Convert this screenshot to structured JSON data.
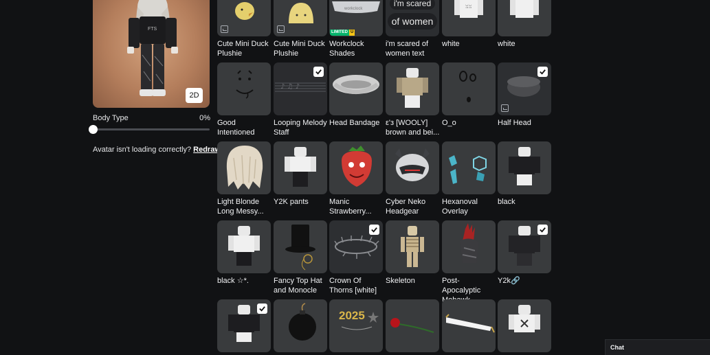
{
  "avatar": {
    "view_toggle": "2D",
    "body_type_label": "Body Type",
    "body_type_value": "0%",
    "body_type_progress": 0,
    "loading_msg": "Avatar isn't loading correctly?",
    "redraw_label": "Redraw"
  },
  "items": [
    {
      "name": "Cute Mini Duck Plushie",
      "equipped": false,
      "badge": "dynamic"
    },
    {
      "name": "Cute Mini Duck Plushie",
      "equipped": false,
      "badge": "dynamic"
    },
    {
      "name": "Workclock Shades",
      "equipped": false,
      "badge": "limited"
    },
    {
      "name": "i'm scared of women text",
      "equipped": false,
      "thumb_text": [
        "i'm scared",
        "of women"
      ]
    },
    {
      "name": "white",
      "equipped": false
    },
    {
      "name": "white",
      "equipped": false
    },
    {
      "name": "Good Intentioned",
      "equipped": false
    },
    {
      "name": "Looping Melody Staff",
      "equipped": true
    },
    {
      "name": "Head Bandage",
      "equipped": false
    },
    {
      "name": "ε'з [WOOLY] brown and bei...",
      "equipped": false
    },
    {
      "name": "O_o",
      "equipped": false
    },
    {
      "name": "Half Head",
      "equipped": true,
      "badge": "dynamic"
    },
    {
      "name": "Light Blonde Long Messy...",
      "equipped": false
    },
    {
      "name": "Y2K pants",
      "equipped": false
    },
    {
      "name": "Manic Strawberry...",
      "equipped": false
    },
    {
      "name": "Cyber Neko Headgear",
      "equipped": false
    },
    {
      "name": "Hexanoval Overlay",
      "equipped": false
    },
    {
      "name": "black",
      "equipped": false
    },
    {
      "name": "black ☆*.",
      "equipped": false
    },
    {
      "name": "Fancy Top Hat and Monocle",
      "equipped": false
    },
    {
      "name": "Crown Of Thorns [white]",
      "equipped": true
    },
    {
      "name": "Skeleton",
      "equipped": false
    },
    {
      "name": "Post-Apocalyptic Mohawk",
      "equipped": false
    },
    {
      "name": "Y2k🔗",
      "equipped": true
    },
    {
      "name": "",
      "equipped": true
    },
    {
      "name": "",
      "equipped": false
    },
    {
      "name": "",
      "equipped": false,
      "thumb_text": [
        "2025"
      ]
    },
    {
      "name": "",
      "equipped": false
    },
    {
      "name": "",
      "equipped": false
    },
    {
      "name": "",
      "equipped": false
    }
  ],
  "badges": {
    "limited": "LIMITED",
    "limited_u": "U"
  },
  "chat": {
    "label": "Chat"
  }
}
